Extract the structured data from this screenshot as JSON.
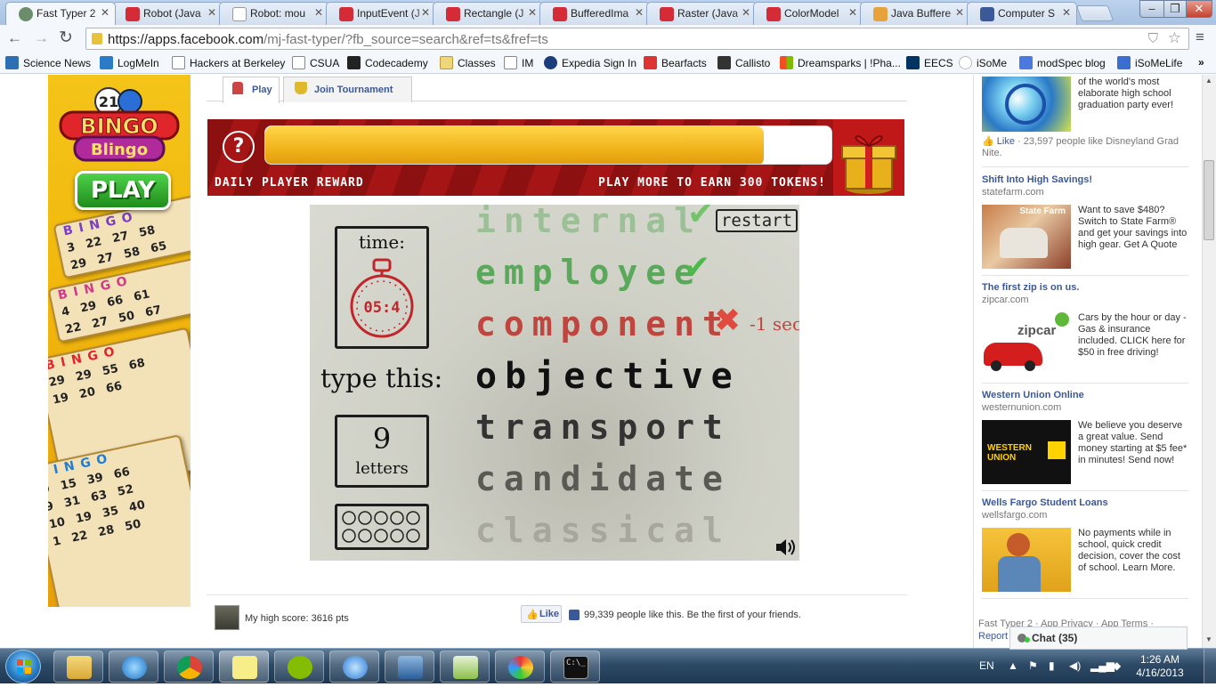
{
  "browser": {
    "tabs": [
      {
        "title": "Fast Typer 2",
        "active": true
      },
      {
        "title": "Robot (Java"
      },
      {
        "title": "Robot: mou"
      },
      {
        "title": "InputEvent (J"
      },
      {
        "title": "Rectangle (J"
      },
      {
        "title": "BufferedIma"
      },
      {
        "title": "Raster (Java"
      },
      {
        "title": "ColorModel"
      },
      {
        "title": "Java Buffere"
      },
      {
        "title": "Computer S"
      }
    ],
    "window_controls": {
      "minimize": "–",
      "maximize": "❐",
      "close": "✕"
    },
    "url_host": "https://apps.facebook.com",
    "url_path": "/mj-fast-typer/?fb_source=search&ref=ts&fref=ts",
    "bookmarks": [
      "Science News",
      "LogMeIn",
      "Hackers at Berkeley",
      "CSUA",
      "Codecademy",
      "Classes",
      "IM",
      "Expedia Sign In",
      "Bearfacts",
      "Callisto",
      "Dreamsparks | !Pha...",
      "EECS",
      "iSoMe",
      "modSpec blog",
      "iSoMeLife"
    ],
    "more_bookmarks": "»"
  },
  "game_tabs": {
    "play": "Play",
    "tournament": "Join Tournament"
  },
  "bingo_ad": {
    "logo_top": "BINGO",
    "logo_bottom": "Blingo",
    "ball_number": "21",
    "play": "PLAY",
    "card_header": "BINGO",
    "card_rows": [
      "3 22 27 58",
      "29 27 58 65",
      "4 29 66 61",
      "22 27 50 67",
      "29 29 55 68",
      "19 20 66",
      "9 15 39 66",
      "9 31 63 52",
      "10 19 35 40",
      "1 22 28 50"
    ]
  },
  "reward": {
    "label": "DAILY PLAYER REWARD",
    "earn": "PLAY MORE TO EARN 300 TOKENS!",
    "help": "?",
    "progress": 0.88
  },
  "game": {
    "time_label": "time:",
    "timer": "05:4",
    "type_label": "type this:",
    "letters_count": "9",
    "letters_label": "letters",
    "restart": "restart",
    "penalty": "-1 sec",
    "words_done": [
      {
        "word": "internal",
        "status": "correct"
      },
      {
        "word": "employee",
        "status": "correct"
      },
      {
        "word": "component",
        "status": "wrong"
      }
    ],
    "current_word": "objective",
    "upcoming": [
      "transport",
      "candidate",
      "classical"
    ]
  },
  "like_bar": {
    "high_score": "My high score: 3616 pts",
    "like": "Like",
    "like_count": "99,339 people like this. Be the first of your friends."
  },
  "sidebar": {
    "top_ad_text": "of the world's most elaborate high school graduation party ever!",
    "top_ad_like": "Like",
    "top_ad_likes": "· 23,597 people like Disneyland Grad Nite.",
    "ads": [
      {
        "title": "Shift Into High Savings!",
        "domain": "statefarm.com",
        "text": "Want to save $480? Switch to State Farm® and get your savings into high gear. Get A Quote",
        "brand": "State Farm"
      },
      {
        "title": "The first zip is on us.",
        "domain": "zipcar.com",
        "text": "Cars by the hour or day - Gas & insurance included. CLICK here for $50 in free driving!",
        "brand": "zipcar"
      },
      {
        "title": "Western Union Online",
        "domain": "westernunion.com",
        "text": "We believe you deserve a great value. Send money starting at $5 fee* in minutes! Send now!",
        "brand": "WESTERN UNION"
      },
      {
        "title": "Wells Fargo Student Loans",
        "domain": "wellsfargo.com",
        "text": "No payments while in school, quick credit decision, cover the cost of school. Learn More.",
        "brand": ""
      }
    ],
    "footer": "Fast Typer 2 · App Privacy · App Terms ·",
    "footer2": "Report",
    "chat": "Chat (35)"
  },
  "taskbar": {
    "lang": "EN",
    "time": "1:26 AM",
    "date": "4/16/2013",
    "cmd_prompt": "C:\\_"
  }
}
